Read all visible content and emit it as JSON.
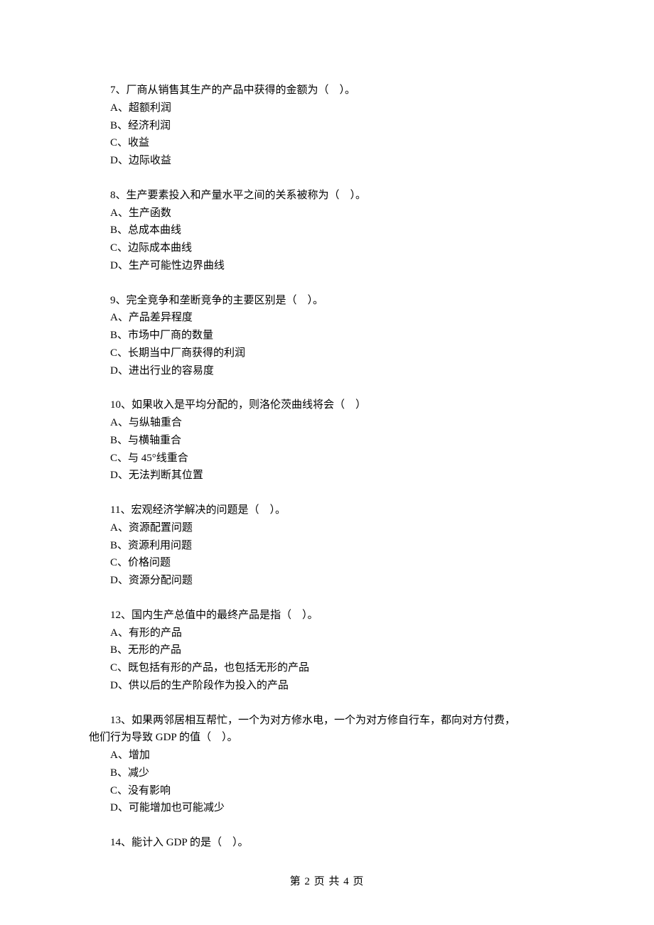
{
  "questions": [
    {
      "stem": "7、厂商从销售其生产的产品中获得的金额为（　）。",
      "options": [
        "A、超额利润",
        "B、经济利润",
        "C、收益",
        "D、边际收益"
      ]
    },
    {
      "stem": "8、生产要素投入和产量水平之间的关系被称为（　）。",
      "options": [
        "A、生产函数",
        "B、总成本曲线",
        "C、边际成本曲线",
        "D、生产可能性边界曲线"
      ]
    },
    {
      "stem": "9、完全竞争和垄断竞争的主要区别是（　）。",
      "options": [
        "A、产品差异程度",
        "B、市场中厂商的数量",
        "C、长期当中厂商获得的利润",
        "D、进出行业的容易度"
      ]
    },
    {
      "stem": "10、如果收入是平均分配的，则洛伦茨曲线将会（　）",
      "options": [
        "A、与纵轴重合",
        "B、与横轴重合",
        "C、与 45°线重合",
        "D、无法判断其位置"
      ]
    },
    {
      "stem": "11、宏观经济学解决的问题是（　）。",
      "options": [
        "A、资源配置问题",
        "B、资源利用问题",
        "C、价格问题",
        "D、资源分配问题"
      ]
    },
    {
      "stem": "12、国内生产总值中的最终产品是指（　）。",
      "options": [
        "A、有形的产品",
        "B、无形的产品",
        "C、既包括有形的产品，也包括无形的产品",
        "D、供以后的生产阶段作为投入的产品"
      ]
    },
    {
      "stem": "13、如果两邻居相互帮忙，一个为对方修水电，一个为对方修自行车，都向对方付费，",
      "cont": "他们行为导致 GDP 的值（　）。",
      "options": [
        "A、增加",
        "B、减少",
        "C、没有影响",
        "D、可能增加也可能减少"
      ]
    },
    {
      "stem": "14、能计入 GDP 的是（　）。",
      "options": []
    }
  ],
  "footer": "第 2 页 共 4 页"
}
